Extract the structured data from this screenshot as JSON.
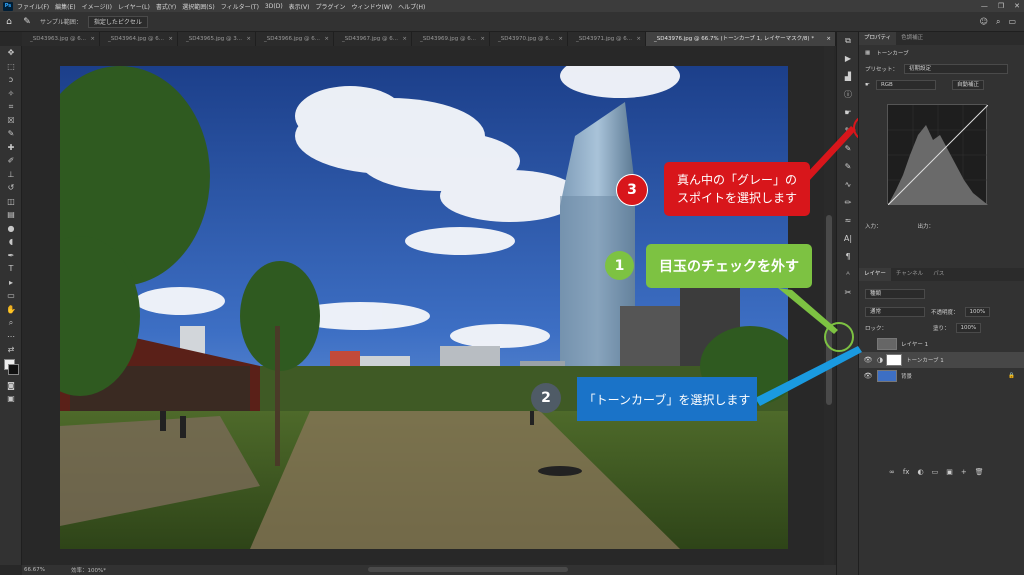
{
  "app": {
    "logo": "Ps"
  },
  "menu": [
    "ファイル(F)",
    "編集(E)",
    "イメージ(I)",
    "レイヤー(L)",
    "書式(Y)",
    "選択範囲(S)",
    "フィルター(T)",
    "3D(D)",
    "表示(V)",
    "プラグイン",
    "ウィンドウ(W)",
    "ヘルプ(H)"
  ],
  "window_controls": {
    "minimize": "—",
    "restore": "❐",
    "close": "✕"
  },
  "options": {
    "sample_label": "サンプル範囲：",
    "sample_value": "指定したピクセル"
  },
  "tabs": [
    {
      "label": "_SD43963.jpg @ 6..."
    },
    {
      "label": "_SD43964.jpg @ 6..."
    },
    {
      "label": "_SD43965.jpg @ 3..."
    },
    {
      "label": "_SD43966.jpg @ 6..."
    },
    {
      "label": "_SD43967.jpg @ 6..."
    },
    {
      "label": "_SD43969.jpg @ 6..."
    },
    {
      "label": "_SD43970.jpg @ 6..."
    },
    {
      "label": "_SD43971.jpg @ 6..."
    },
    {
      "label": "_SD43976.jpg @ 66.7% (トーンカーブ 1, レイヤーマスク/8) *"
    }
  ],
  "tab_close": "×",
  "status": {
    "zoom": "66.67%",
    "efficiency": "効率：100%*"
  },
  "properties": {
    "tabs": [
      "プロパティ",
      "色調補正"
    ],
    "type": "トーンカーブ",
    "preset_label": "プリセット：",
    "preset_value": "初期設定",
    "channel": "RGB",
    "auto_button": "自動補正",
    "input_label": "入力：",
    "output_label": "出力："
  },
  "layers": {
    "tabs": [
      "レイヤー",
      "チャンネル",
      "パス"
    ],
    "filter": "種類",
    "blend": "通常",
    "opacity_label": "不透明度：",
    "opacity_value": "100%",
    "lock_label": "ロック：",
    "fill_label": "塗り：",
    "fill_value": "100%",
    "items": [
      {
        "name": "レイヤー 1"
      },
      {
        "name": "トーンカーブ 1"
      },
      {
        "name": "背景"
      }
    ],
    "bottom_icons": [
      "∞",
      "fx",
      "◐",
      "▭",
      "▣",
      "+",
      "🗑"
    ]
  },
  "annotations": {
    "step1": {
      "num": "1",
      "text": "目玉のチェックを外す"
    },
    "step2": {
      "num": "2",
      "text": "「トーンカーブ」を選択します"
    },
    "step3": {
      "num": "3",
      "line1": "真ん中の「グレー」の",
      "line2": "スポイトを選択します"
    }
  },
  "colors": {
    "green": "#7dc242",
    "blue": "#1a73c8",
    "red": "#d8161b",
    "gray_num": "#4f5b66"
  }
}
